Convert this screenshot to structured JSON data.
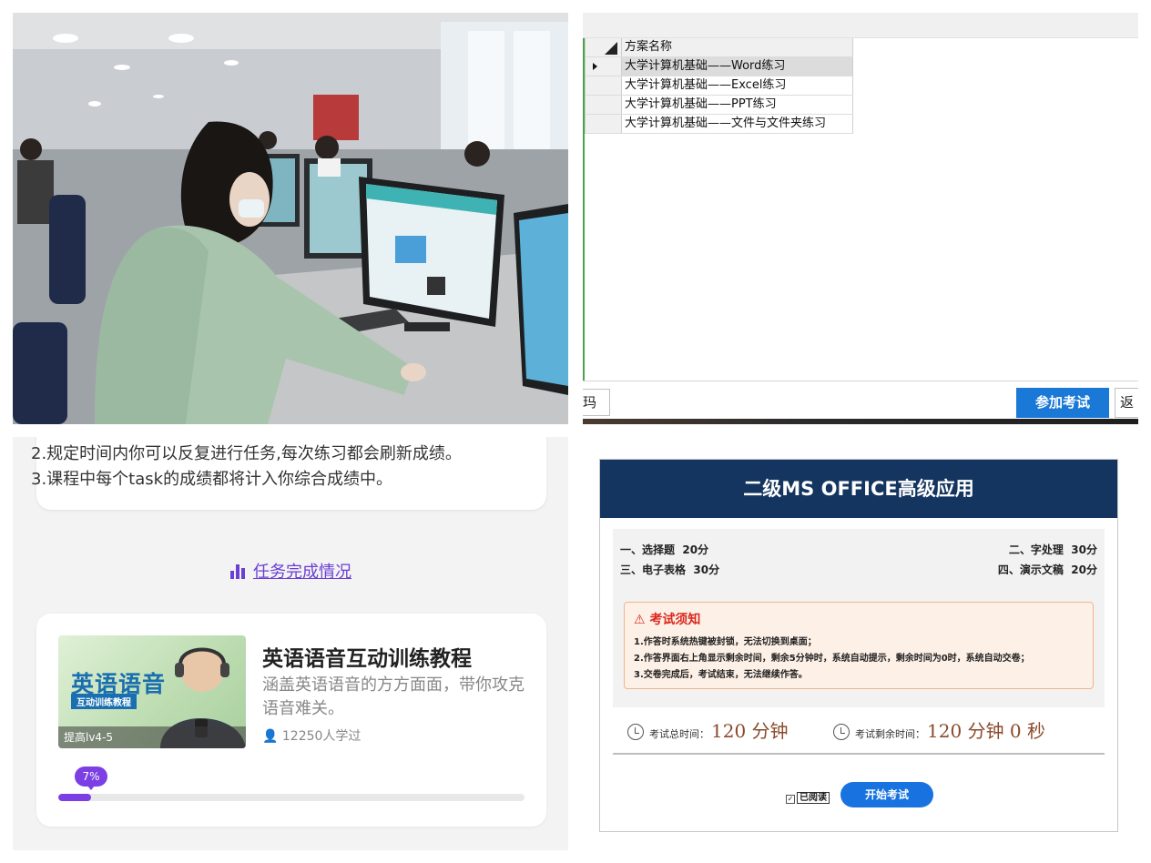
{
  "list_panel": {
    "column_header": "方案名称",
    "rows": [
      "大学计算机基础——Word练习",
      "大学计算机基础——Excel练习",
      "大学计算机基础——PPT练习",
      "大学计算机基础——文件与文件夹练习"
    ],
    "selected_index": 0,
    "code_field_text": "玛",
    "join_exam_label": "参加考试",
    "return_label": "返"
  },
  "course_panel": {
    "rules": [
      "2.规定时间内你可以反复进行任务,每次练习都会刷新成绩。",
      "3.课程中每个task的成绩都将计入你综合成绩中。"
    ],
    "task_status_label": "任务完成情况",
    "course": {
      "thumb_title": "英语语音",
      "thumb_subtitle": "互动训练教程",
      "thumb_level": "提高lv4-5",
      "title": "英语语音互动训练教程",
      "description": "涵盖英语语音的方方面面，带你攻克语音难关。",
      "learners": "12250人学过",
      "progress_label": "7%",
      "progress_value": 0.07
    },
    "accent_color": "#7b3fe4"
  },
  "exam_panel": {
    "title": "二级MS OFFICE高级应用",
    "sections": [
      {
        "name": "一、选择题",
        "points": "20分"
      },
      {
        "name": "二、字处理",
        "points": "30分"
      },
      {
        "name": "三、电子表格",
        "points": "30分"
      },
      {
        "name": "四、演示文稿",
        "points": "20分"
      }
    ],
    "notice_title": "考试须知",
    "notice_lines": [
      "1.作答时系统热键被封锁，无法切换到桌面；",
      "2.作答界面右上角显示剩余时间，剩余5分钟时，系统自动提示，剩余时间为0时，系统自动交卷；",
      "3.交卷完成后，考试结束，无法继续作答。"
    ],
    "total_time_label": "考试总时间：",
    "total_time_value": "120 分钟",
    "remaining_time_label": "考试剩余时间：",
    "remaining_time_value": "120 分钟 0 秒",
    "read_label": "已阅读",
    "start_label": "开始考试",
    "header_color": "#14355f",
    "button_color": "#1872e0"
  }
}
